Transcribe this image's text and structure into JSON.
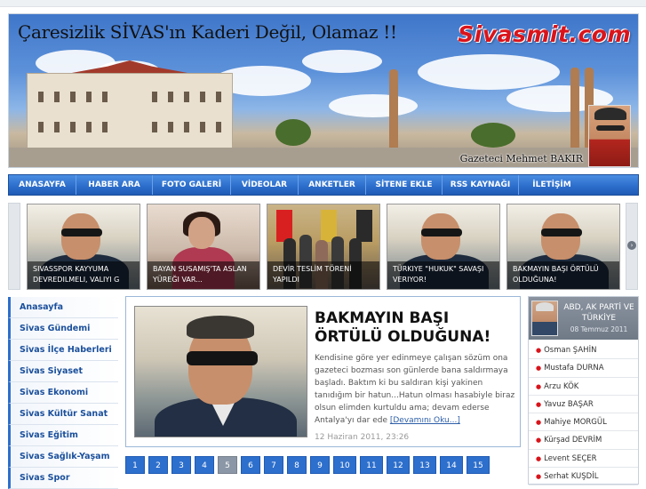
{
  "banner": {
    "slogan": "Çaresizlik SİVAS'ın Kaderi Değil, Olamaz !!",
    "logo": "Sivasmit.com",
    "journalist": "Gazeteci Mehmet BAKIR"
  },
  "nav": {
    "items": [
      "ANASAYFA",
      "HABER ARA",
      "FOTO GALERİ",
      "VİDEOLAR",
      "ANKETLER",
      "SİTENE EKLE",
      "RSS KAYNAĞI",
      "İLETİŞİM"
    ]
  },
  "carousel": {
    "slides": [
      {
        "caption": "SIVASSPOR KAYYUMA DEVREDILMELI, VALIYI G"
      },
      {
        "caption": "BAYAN SUSAMIŞ'TA ASLAN YÜREĞI VAR..."
      },
      {
        "caption": "DEVİR TESLİM TÖRENİ YAPILDI"
      },
      {
        "caption": "TÜRKIYE \"HUKUK\" SAVAŞI VERIYOR!"
      },
      {
        "caption": "BAKMAYIN BAŞI ÖRTÜLÜ OLDUĞUNA!"
      }
    ],
    "next_glyph": "›"
  },
  "left_sidebar": {
    "items": [
      "Anasayfa",
      "Sivas Gündemi",
      "Sivas İlçe Haberleri",
      "Sivas Siyaset",
      "Sivas Ekonomi",
      "Sivas Kültür Sanat",
      "Sivas Eğitim",
      "Sivas Sağlık-Yaşam",
      "Sivas Spor"
    ]
  },
  "article": {
    "title": "BAKMAYIN BAŞI ÖRTÜLÜ OLDUĞUNA!",
    "text": "Kendisine göre yer edinmeye çalışan sözüm ona gazeteci bozması son günlerde bana saldırmaya başladı. Baktım ki bu saldıran kişi yakinen tanıdığım bir hatun...Hatun olması hasabiyle biraz olsun elimden kurtuldu ama; devam ederse Antalya'yı dar ede ",
    "more": "[Devamını Oku...]",
    "date": "12 Haziran 2011, 23:26"
  },
  "pagination": {
    "pages": [
      "1",
      "2",
      "3",
      "4",
      "5",
      "6",
      "7",
      "8",
      "9",
      "10",
      "11",
      "12",
      "13",
      "14",
      "15"
    ],
    "active": "5"
  },
  "right_sidebar": {
    "title": "ABD, AK PARTİ VE TÜRKİYE",
    "date": "08 Temmuz 2011",
    "authors": [
      "Osman ŞAHİN",
      "Mustafa DURNA",
      "Arzu KÖK",
      "Yavuz BAŞAR",
      "Mahiye MORGÜL",
      "Kürşad DEVRİM",
      "Levent SEÇER",
      "Serhat KUŞDİL"
    ]
  },
  "colors": {
    "accent": "#2d6fcc",
    "logo": "#d9141b"
  }
}
